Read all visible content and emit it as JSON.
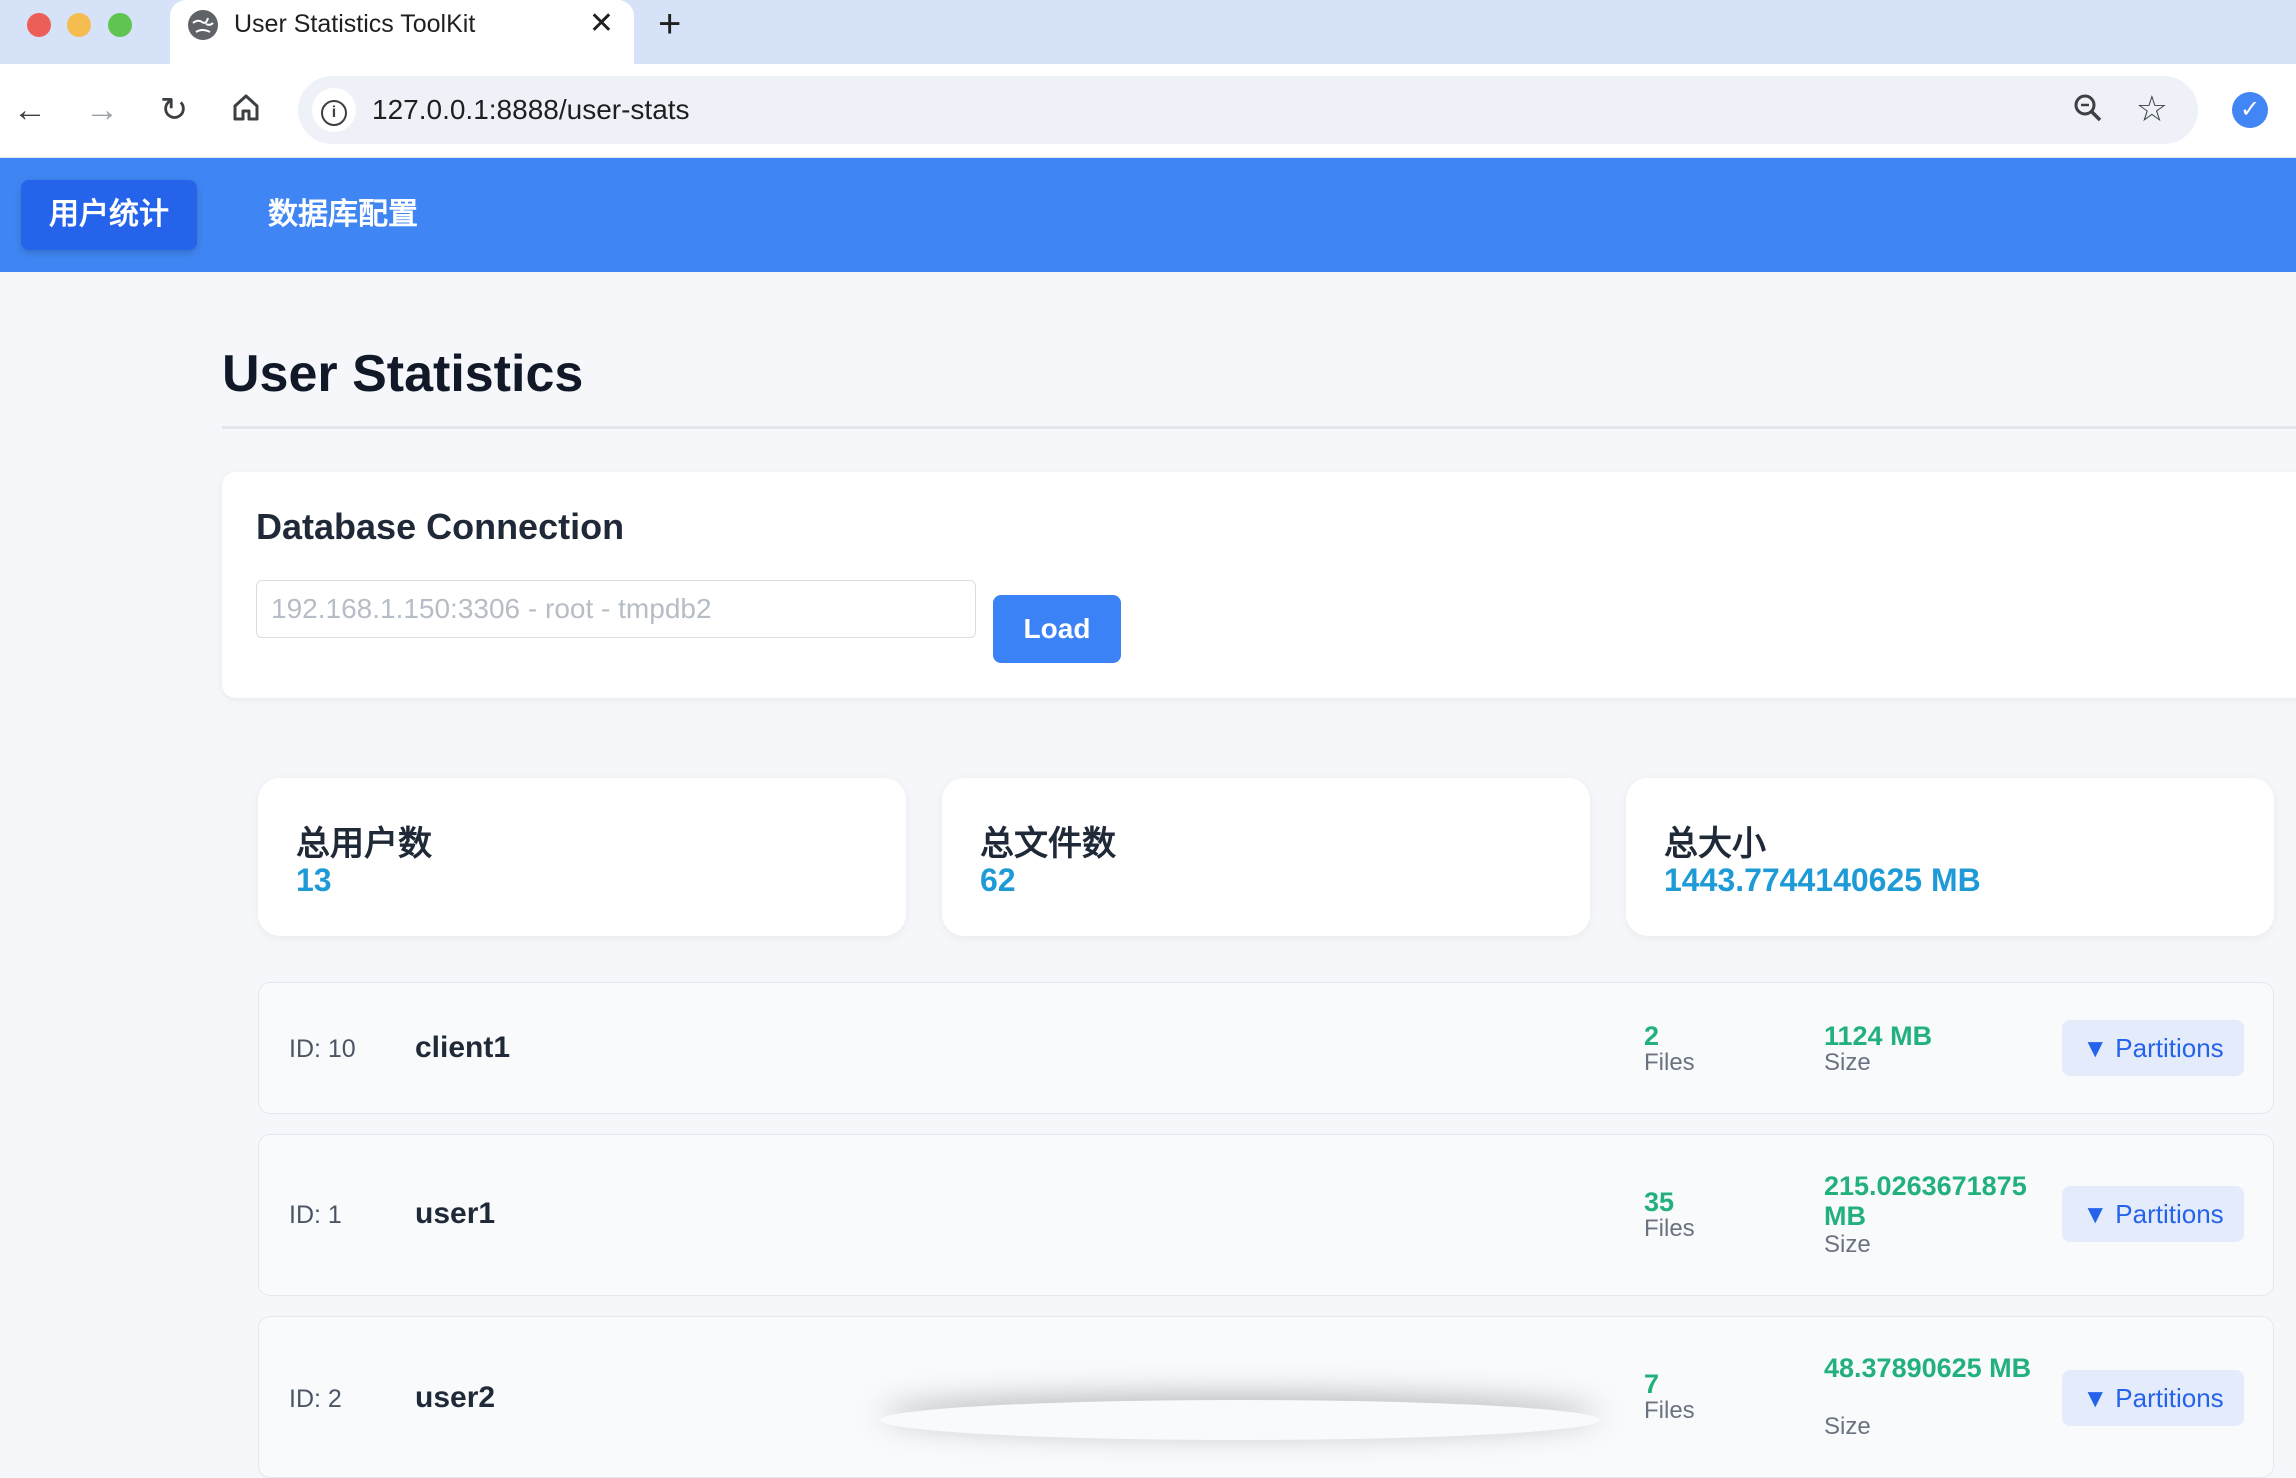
{
  "browser": {
    "tab_title": "User Statistics ToolKit",
    "url": "127.0.0.1:8888/user-stats"
  },
  "icons": {
    "back": "arrow-left",
    "forward": "arrow-right",
    "reload": "reload",
    "home": "home",
    "site_info": "info",
    "zoom": "magnifier",
    "bookmark": "star",
    "profile": "profile-avatar",
    "tab_close": "close",
    "new_tab": "plus",
    "partition_toggle": "triangle-down"
  },
  "colors": {
    "nav_bg": "#3f86f4",
    "nav_active": "#2563eb",
    "accent": "#3b82f6",
    "stat_value": "#1e9bd7",
    "row_value": "#22b07d"
  },
  "nav": {
    "user_stats": "用户统计",
    "db_config": "数据库配置"
  },
  "page": {
    "title": "User Statistics"
  },
  "connection": {
    "title": "Database Connection",
    "placeholder": "192.168.1.150:3306 - root - tmpdb2",
    "load_label": "Load"
  },
  "stats": [
    {
      "label": "总用户数",
      "value": "13"
    },
    {
      "label": "总文件数",
      "value": "62"
    },
    {
      "label": "总大小",
      "value": "1443.7744140625 MB"
    }
  ],
  "users": [
    {
      "id": "ID: 10",
      "name": "client1",
      "files": "2",
      "files_label": "Files",
      "size": "1124 MB",
      "size_label": "Size",
      "partitions_label": "▼ Partitions"
    },
    {
      "id": "ID: 1",
      "name": "user1",
      "files": "35",
      "files_label": "Files",
      "size": "215.0263671875 MB",
      "size_label": "Size",
      "partitions_label": "▼ Partitions"
    },
    {
      "id": "ID: 2",
      "name": "user2",
      "files": "7",
      "files_label": "Files",
      "size": "48.37890625 MB",
      "size_label": "Size",
      "partitions_label": "▼ Partitions"
    }
  ]
}
